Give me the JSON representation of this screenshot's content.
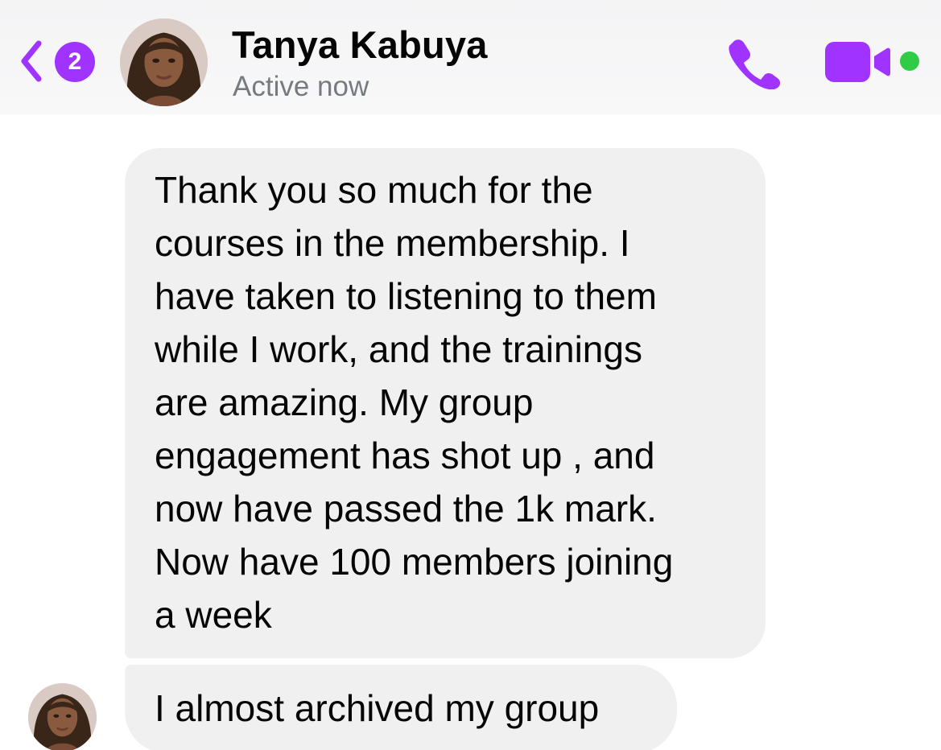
{
  "header": {
    "back_badge_count": "2",
    "contact_name": "Tanya Kabuya",
    "contact_status": "Active now",
    "icons": {
      "back": "chevron-left-icon",
      "call": "phone-icon",
      "video": "video-camera-icon",
      "online": "online-status-dot"
    }
  },
  "messages": [
    {
      "sender": "Tanya Kabuya",
      "text": "Thank you so much for the\ncourses in the membership. I\nhave taken to listening to them\nwhile I work, and the trainings\nare amazing. My group\nengagement has shot up , and\nnow have passed the 1k mark.\nNow have 100 members joining\na week"
    },
    {
      "sender": "Tanya Kabuya",
      "text": "I almost archived my group"
    }
  ],
  "colors": {
    "accent": "#a033ff",
    "online": "#31cc46",
    "bubble_background": "#f0f0f0",
    "status_text": "#777b80"
  }
}
